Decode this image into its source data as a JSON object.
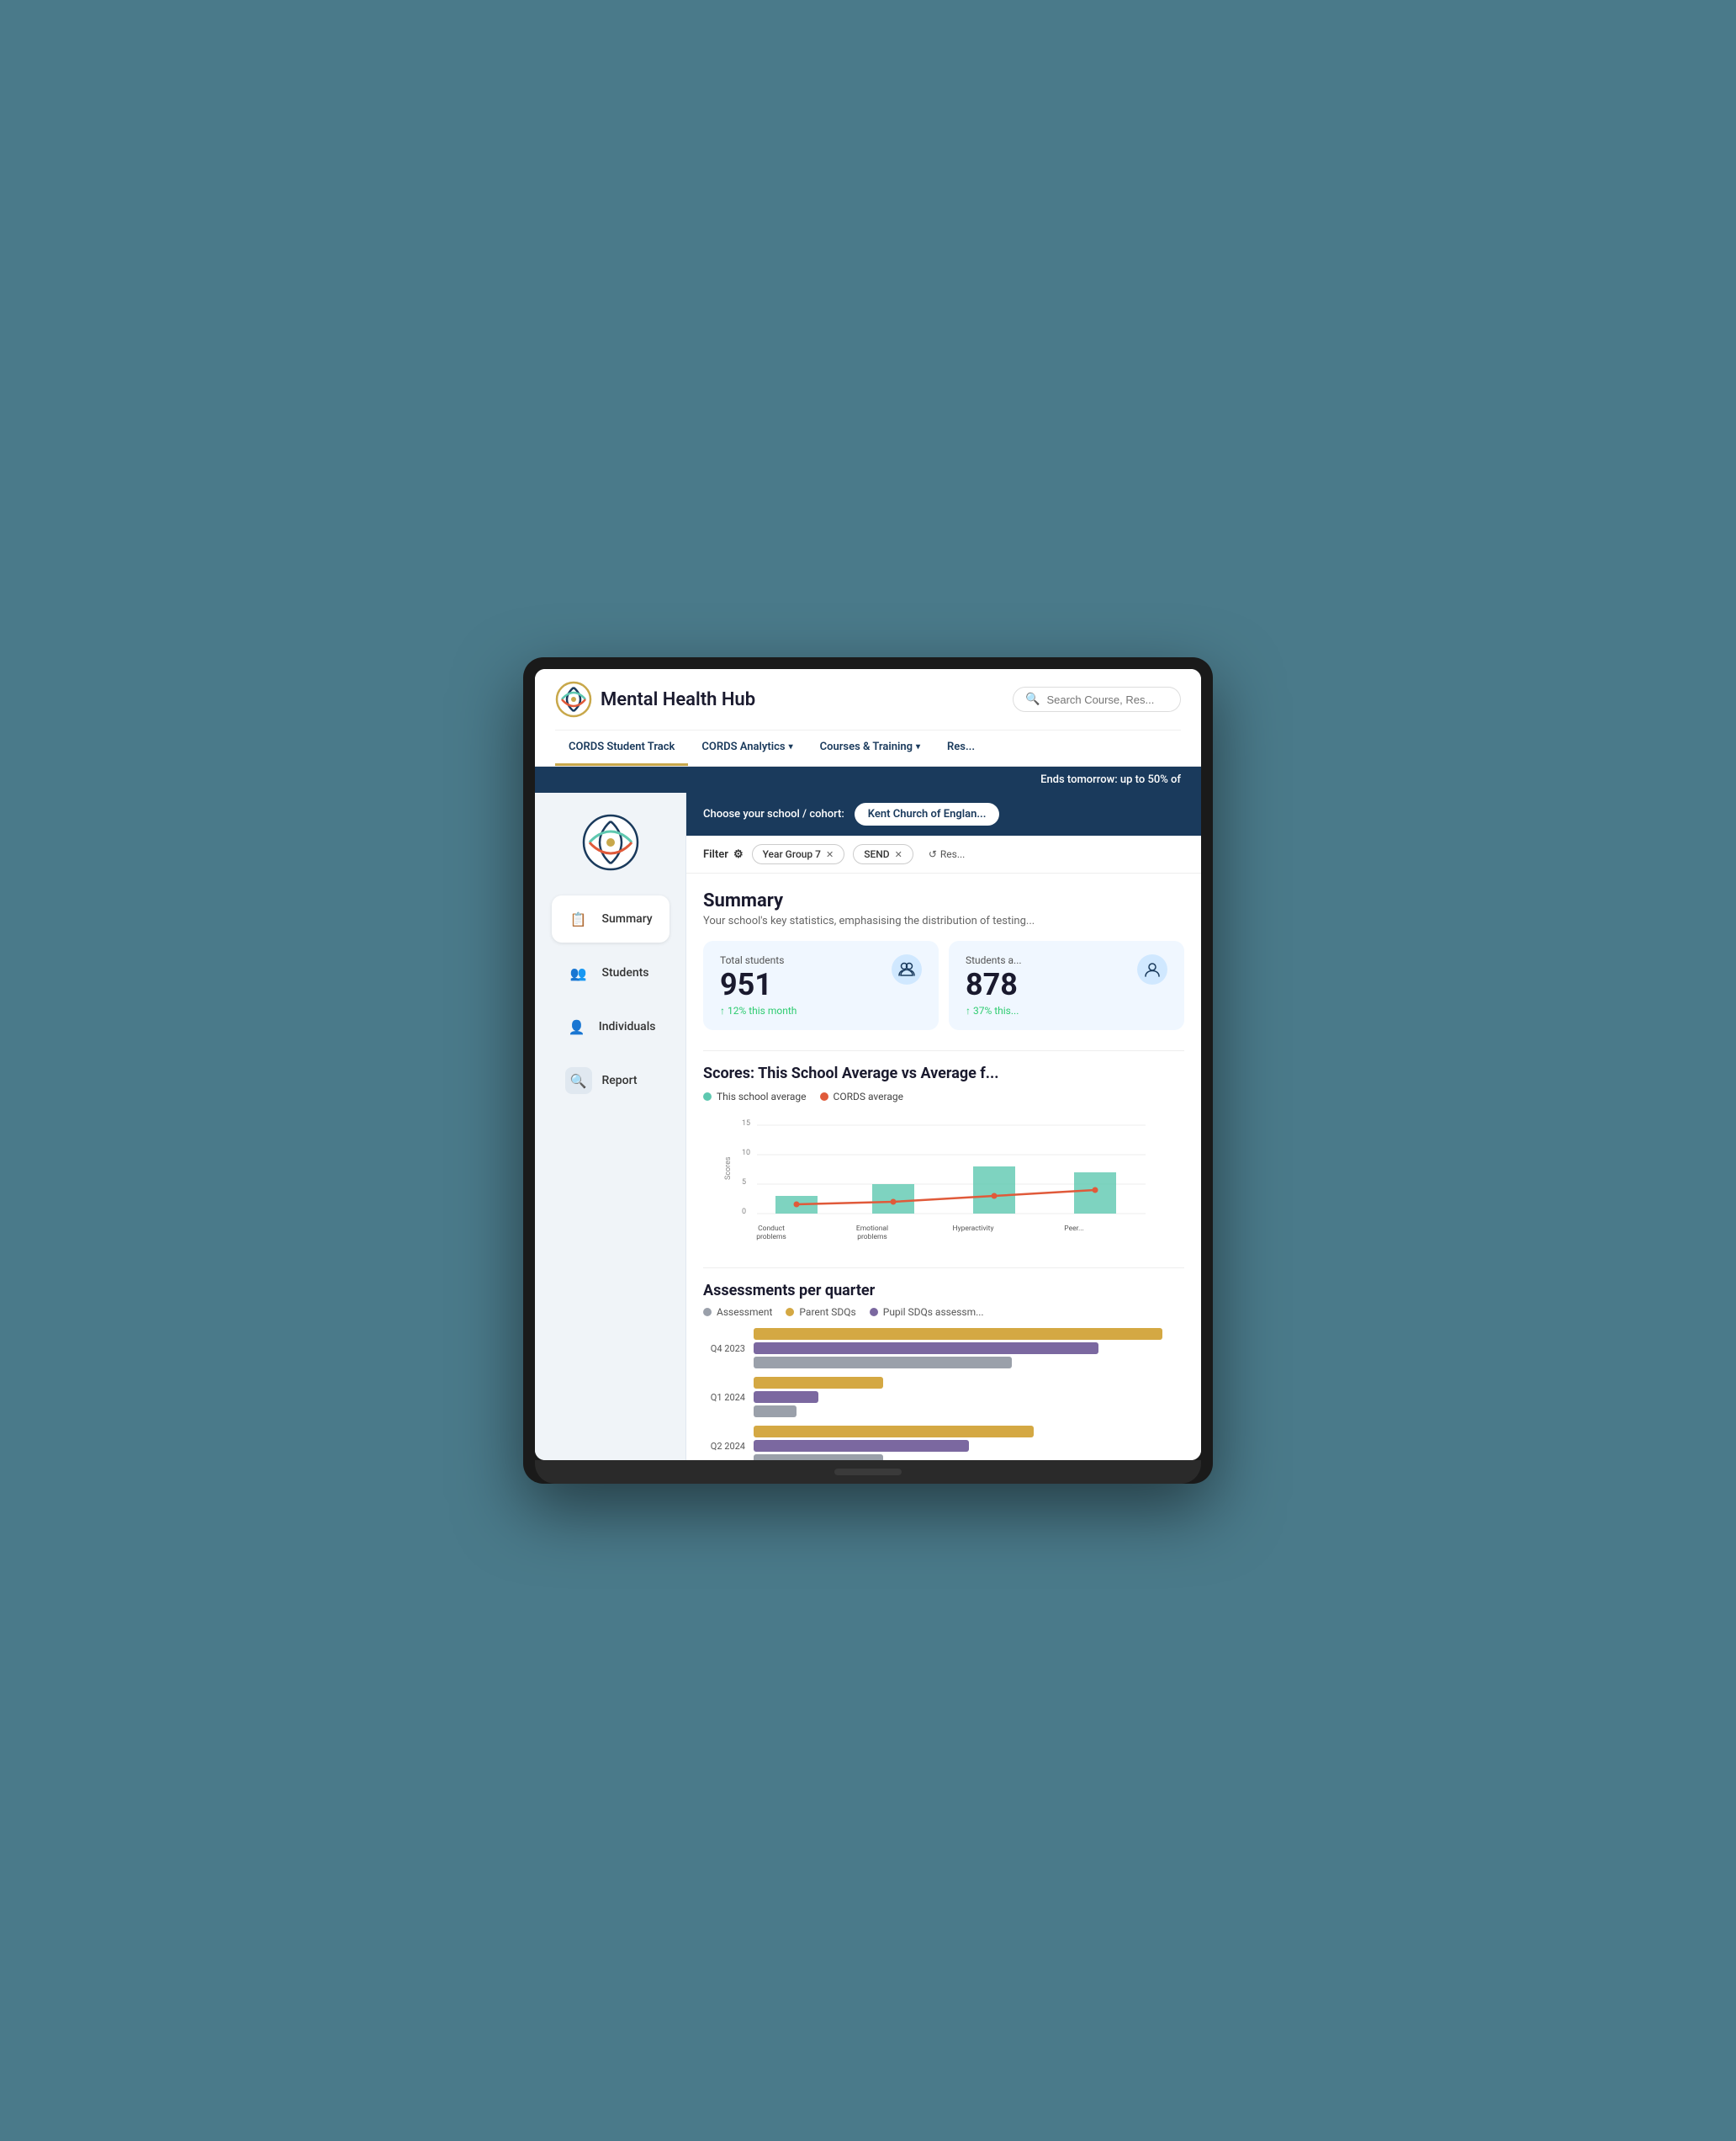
{
  "app": {
    "title": "Mental Health Hub",
    "logo_alt": "MHH Logo"
  },
  "header": {
    "search_placeholder": "Search Course, Res...",
    "nav_items": [
      {
        "label": "CORDS Student Track",
        "active": false
      },
      {
        "label": "CORDS Analytics",
        "has_dropdown": true,
        "active": true
      },
      {
        "label": "Courses & Training",
        "has_dropdown": true,
        "active": false
      },
      {
        "label": "Res...",
        "has_dropdown": false,
        "active": false
      }
    ],
    "promo_text": "Ends tomorrow: up to 50% of"
  },
  "sidebar": {
    "items": [
      {
        "label": "Summary",
        "icon": "📋",
        "active": true,
        "id": "summary"
      },
      {
        "label": "Students",
        "icon": "👥",
        "active": false,
        "id": "students"
      },
      {
        "label": "Individuals",
        "icon": "👤",
        "active": false,
        "id": "individuals"
      },
      {
        "label": "Report",
        "icon": "🔍",
        "active": false,
        "id": "report"
      }
    ]
  },
  "school_selector": {
    "label": "Choose your school / cohort:",
    "value": "Kent Church of Englan..."
  },
  "filters": {
    "label": "Filter",
    "tags": [
      {
        "label": "Year Group 7"
      },
      {
        "label": "SEND"
      }
    ],
    "reset_label": "Res..."
  },
  "summary": {
    "title": "Summary",
    "description": "Your school's key statistics, emphasising the distribution of testing...",
    "stats": [
      {
        "label": "Total students",
        "value": "951",
        "change": "↑ 12% this month",
        "icon": "👥"
      },
      {
        "label": "Students a...",
        "value": "878",
        "change": "↑ 37% this...",
        "icon": "👥"
      }
    ]
  },
  "scores_chart": {
    "title": "Scores: This School Average vs Average f...",
    "legend": [
      {
        "label": "This school average",
        "color": "#5ec8b0"
      },
      {
        "label": "CORDS average",
        "color": "#e05a3a"
      }
    ],
    "y_labels": [
      "15",
      "10",
      "5",
      "0"
    ],
    "x_labels": [
      "Conduct problems",
      "Emotional problems",
      "Hyperactivity",
      "Peer..."
    ],
    "y_axis_label": "Scores",
    "bars": [
      {
        "category": "Conduct problems",
        "school": 3,
        "cords": 1.5
      },
      {
        "category": "Emotional problems",
        "school": 5,
        "cords": 2
      },
      {
        "category": "Hyperactivity",
        "school": 8,
        "cords": 3
      },
      {
        "category": "Peer",
        "school": 7,
        "cords": 4
      }
    ]
  },
  "assessments": {
    "title": "Assessments per quarter",
    "legend": [
      {
        "label": "Assessment",
        "color": "#888"
      },
      {
        "label": "Parent SDQs",
        "color": "#d4a843"
      },
      {
        "label": "Pupil SDQs assessm...",
        "color": "#7b68a0"
      }
    ],
    "quarters": [
      {
        "label": "Q4 2023",
        "parent": 95,
        "pupil": 80,
        "assess": 60
      },
      {
        "label": "Q1 2024",
        "parent": 30,
        "pupil": 15,
        "assess": 10
      },
      {
        "label": "Q2 2024",
        "parent": 65,
        "pupil": 50,
        "assess": 30
      }
    ]
  }
}
